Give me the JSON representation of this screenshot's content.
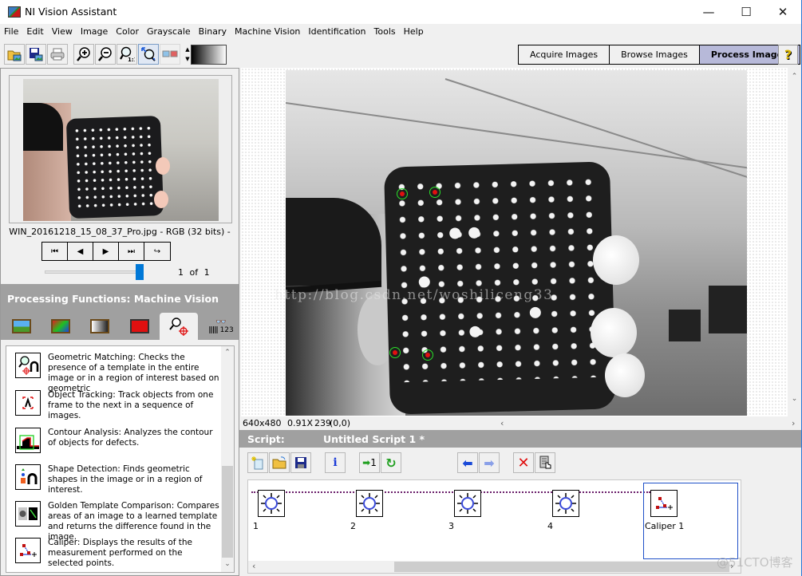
{
  "window": {
    "title": "NI Vision Assistant",
    "controls": {
      "minimize": "—",
      "maximize": "☐",
      "close": "✕"
    }
  },
  "menubar": [
    "File",
    "Edit",
    "View",
    "Image",
    "Color",
    "Grayscale",
    "Binary",
    "Machine Vision",
    "Identification",
    "Tools",
    "Help"
  ],
  "toolbar": {
    "buttons": [
      "open-image-icon",
      "save-image-icon",
      "print-icon",
      "zoom-in-icon",
      "zoom-out-icon",
      "zoom-1-1-icon",
      "zoom-fit-icon",
      "compare-images-icon"
    ],
    "zoom_1_1_label": "1:1",
    "mode_tabs": [
      {
        "label": "Acquire Images",
        "active": false
      },
      {
        "label": "Browse Images",
        "active": false
      },
      {
        "label": "Process Images",
        "active": true
      }
    ],
    "help_label": "?"
  },
  "browser": {
    "filename": "WIN_20161218_15_08_37_Pro.jpg - RGB (32 bits) -",
    "nav": [
      "⏮",
      "◀",
      "▶",
      "⏭",
      "↪"
    ],
    "slider_position_fraction": 1.0,
    "counter": {
      "current": "1",
      "of": "of",
      "total": "1"
    }
  },
  "processing_functions": {
    "title": "Processing Functions: Machine Vision",
    "category_tabs": [
      {
        "name": "image",
        "active": false
      },
      {
        "name": "color",
        "active": false
      },
      {
        "name": "grayscale",
        "active": false
      },
      {
        "name": "binary",
        "active": false
      },
      {
        "name": "machine-vision",
        "active": true
      },
      {
        "name": "identification",
        "active": false
      }
    ],
    "identification_tab_label": "123",
    "items": [
      {
        "icon": "geometric-matching-icon",
        "text": "Geometric Matching:  Checks the presence of a template in the entire image or in a region of interest based on geometric"
      },
      {
        "icon": "object-tracking-icon",
        "text": "Object Tracking:  Track objects from one frame to the next in a sequence of images."
      },
      {
        "icon": "contour-analysis-icon",
        "text": "Contour Analysis:  Analyzes the contour of objects for defects."
      },
      {
        "icon": "shape-detection-icon",
        "text": "Shape Detection:  Finds geometric shapes in the image or in a region of interest."
      },
      {
        "icon": "golden-template-icon",
        "text": "Golden Template Comparison:  Compares areas of an image to a learned template and returns the difference found in the image."
      },
      {
        "icon": "caliper-icon",
        "text": "Caliper:  Displays the results of the measurement performed on the selected points."
      }
    ]
  },
  "viewer": {
    "watermark": "http://blog.csdn.net/woshiliceng33",
    "status": {
      "size": "640x480",
      "zoom": "0.91X",
      "value": "239",
      "coords": "(0,0)"
    }
  },
  "script": {
    "label": "Script:",
    "name": "Untitled Script 1 *",
    "toolbar": [
      "new-script-icon",
      "open-script-icon",
      "save-script-icon",
      "info-icon",
      "run-once-icon",
      "run-loop-icon",
      "step-back-icon",
      "step-forward-icon",
      "delete-step-icon",
      "edit-step-icon"
    ],
    "run_once_label": "1",
    "info_label": "i",
    "steps": [
      {
        "label": "1",
        "type": "circle-detection"
      },
      {
        "label": "2",
        "type": "circle-detection"
      },
      {
        "label": "3",
        "type": "circle-detection"
      },
      {
        "label": "4",
        "type": "circle-detection"
      },
      {
        "label": "Caliper 1",
        "type": "caliper",
        "selected": true
      }
    ]
  },
  "site_watermark": "@51CTO博客"
}
